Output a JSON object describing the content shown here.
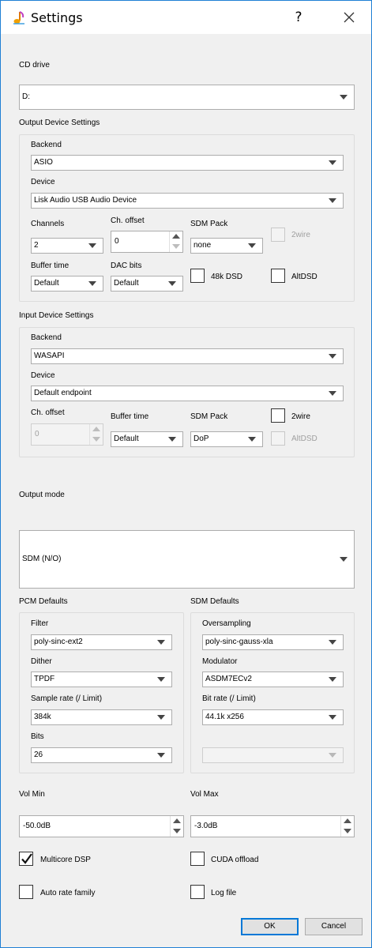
{
  "window": {
    "title": "Settings",
    "help_glyph": "?"
  },
  "cd_drive": {
    "label": "CD drive",
    "value": "D:"
  },
  "output_device": {
    "group_label": "Output Device Settings",
    "backend_label": "Backend",
    "backend_value": "ASIO",
    "device_label": "Device",
    "device_value": "Lisk Audio USB Audio Device",
    "channels_label": "Channels",
    "channels_value": "2",
    "ch_offset_label": "Ch. offset",
    "ch_offset_value": "0",
    "sdm_pack_label": "SDM Pack",
    "sdm_pack_value": "none",
    "twowire_label": "2wire",
    "buffer_time_label": "Buffer time",
    "buffer_time_value": "Default",
    "dac_bits_label": "DAC bits",
    "dac_bits_value": "Default",
    "dsd48k_label": "48k DSD",
    "altdsd_label": "AltDSD"
  },
  "input_device": {
    "group_label": "Input Device Settings",
    "backend_label": "Backend",
    "backend_value": "WASAPI",
    "device_label": "Device",
    "device_value": "Default endpoint",
    "ch_offset_label": "Ch. offset",
    "ch_offset_value": "0",
    "buffer_time_label": "Buffer time",
    "buffer_time_value": "Default",
    "sdm_pack_label": "SDM Pack",
    "sdm_pack_value": "DoP",
    "twowire_label": "2wire",
    "altdsd_label": "AltDSD"
  },
  "output_mode": {
    "label": "Output mode",
    "value": "SDM (N/O)"
  },
  "pcm_defaults": {
    "group_label": "PCM Defaults",
    "filter_label": "Filter",
    "filter_value": "poly-sinc-ext2",
    "dither_label": "Dither",
    "dither_value": "TPDF",
    "sample_rate_label": "Sample rate (/ Limit)",
    "sample_rate_value": "384k",
    "bits_label": "Bits",
    "bits_value": "26"
  },
  "sdm_defaults": {
    "group_label": "SDM Defaults",
    "oversampling_label": "Oversampling",
    "oversampling_value": "poly-sinc-gauss-xla",
    "modulator_label": "Modulator",
    "modulator_value": "ASDM7ECv2",
    "bit_rate_label": "Bit rate (/ Limit)",
    "bit_rate_value": "44.1k x256",
    "extra_value": ""
  },
  "volume": {
    "min_label": "Vol Min",
    "min_value": "-50.0dB",
    "max_label": "Vol Max",
    "max_value": "-3.0dB"
  },
  "options": {
    "multicore_label": "Multicore DSP",
    "multicore_checked": true,
    "cuda_label": "CUDA offload",
    "cuda_checked": false,
    "auto_rate_label": "Auto rate family",
    "auto_rate_checked": false,
    "log_file_label": "Log file",
    "log_file_checked": false
  },
  "buttons": {
    "ok_label": "OK",
    "cancel_label": "Cancel"
  },
  "colors": {
    "accent": "#0078d7",
    "window_border": "#1f7fd4",
    "face": "#f0f0f0"
  }
}
